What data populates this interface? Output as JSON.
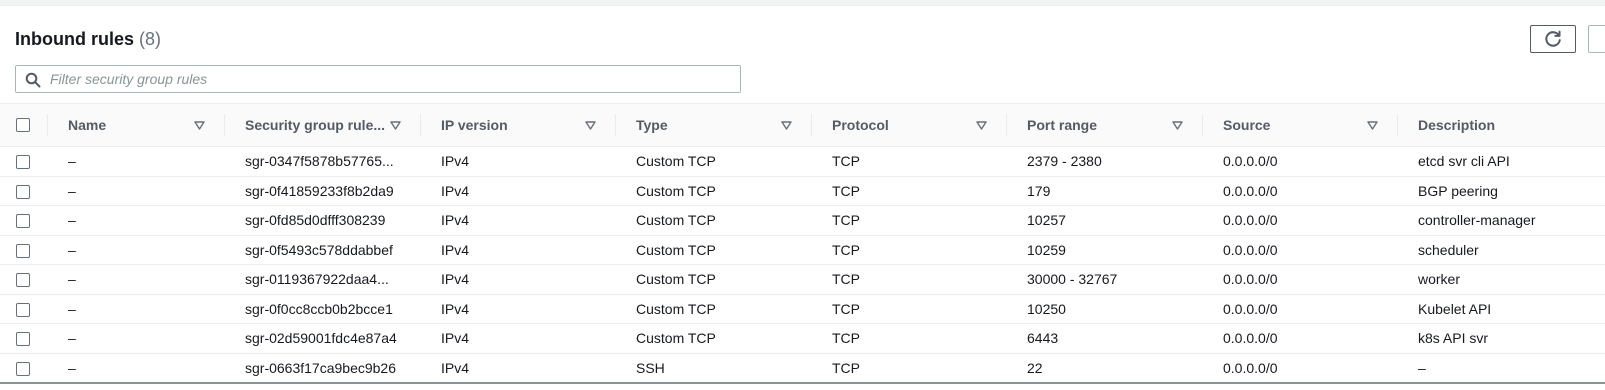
{
  "header": {
    "title": "Inbound rules",
    "count": "(8)"
  },
  "search": {
    "placeholder": "Filter security group rules",
    "value": ""
  },
  "columns": [
    {
      "label": "Name"
    },
    {
      "label": "Security group rule..."
    },
    {
      "label": "IP version"
    },
    {
      "label": "Type"
    },
    {
      "label": "Protocol"
    },
    {
      "label": "Port range"
    },
    {
      "label": "Source"
    },
    {
      "label": "Description"
    }
  ],
  "rows": [
    {
      "name": "–",
      "rule_id": "sgr-0347f5878b57765...",
      "ip_version": "IPv4",
      "type": "Custom TCP",
      "protocol": "TCP",
      "port_range": "2379 - 2380",
      "source": "0.0.0.0/0",
      "description": "etcd svr cli API"
    },
    {
      "name": "–",
      "rule_id": "sgr-0f41859233f8b2da9",
      "ip_version": "IPv4",
      "type": "Custom TCP",
      "protocol": "TCP",
      "port_range": "179",
      "source": "0.0.0.0/0",
      "description": "BGP peering"
    },
    {
      "name": "–",
      "rule_id": "sgr-0fd85d0dfff308239",
      "ip_version": "IPv4",
      "type": "Custom TCP",
      "protocol": "TCP",
      "port_range": "10257",
      "source": "0.0.0.0/0",
      "description": "controller-manager"
    },
    {
      "name": "–",
      "rule_id": "sgr-0f5493c578ddabbef",
      "ip_version": "IPv4",
      "type": "Custom TCP",
      "protocol": "TCP",
      "port_range": "10259",
      "source": "0.0.0.0/0",
      "description": "scheduler"
    },
    {
      "name": "–",
      "rule_id": "sgr-0119367922daa4...",
      "ip_version": "IPv4",
      "type": "Custom TCP",
      "protocol": "TCP",
      "port_range": "30000 - 32767",
      "source": "0.0.0.0/0",
      "description": "worker"
    },
    {
      "name": "–",
      "rule_id": "sgr-0f0cc8ccb0b2bcce1",
      "ip_version": "IPv4",
      "type": "Custom TCP",
      "protocol": "TCP",
      "port_range": "10250",
      "source": "0.0.0.0/0",
      "description": "Kubelet API"
    },
    {
      "name": "–",
      "rule_id": "sgr-02d59001fdc4e87a4",
      "ip_version": "IPv4",
      "type": "Custom TCP",
      "protocol": "TCP",
      "port_range": "6443",
      "source": "0.0.0.0/0",
      "description": "k8s API svr"
    },
    {
      "name": "–",
      "rule_id": "sgr-0663f17ca9bec9b26",
      "ip_version": "IPv4",
      "type": "SSH",
      "protocol": "TCP",
      "port_range": "22",
      "source": "0.0.0.0/0",
      "description": "–"
    }
  ],
  "icons": {
    "search": "search-icon",
    "refresh": "refresh-icon",
    "sort": "sort-down-icon"
  },
  "colors": {
    "text": "#16191f",
    "muted": "#687078",
    "border": "#eaeded"
  }
}
